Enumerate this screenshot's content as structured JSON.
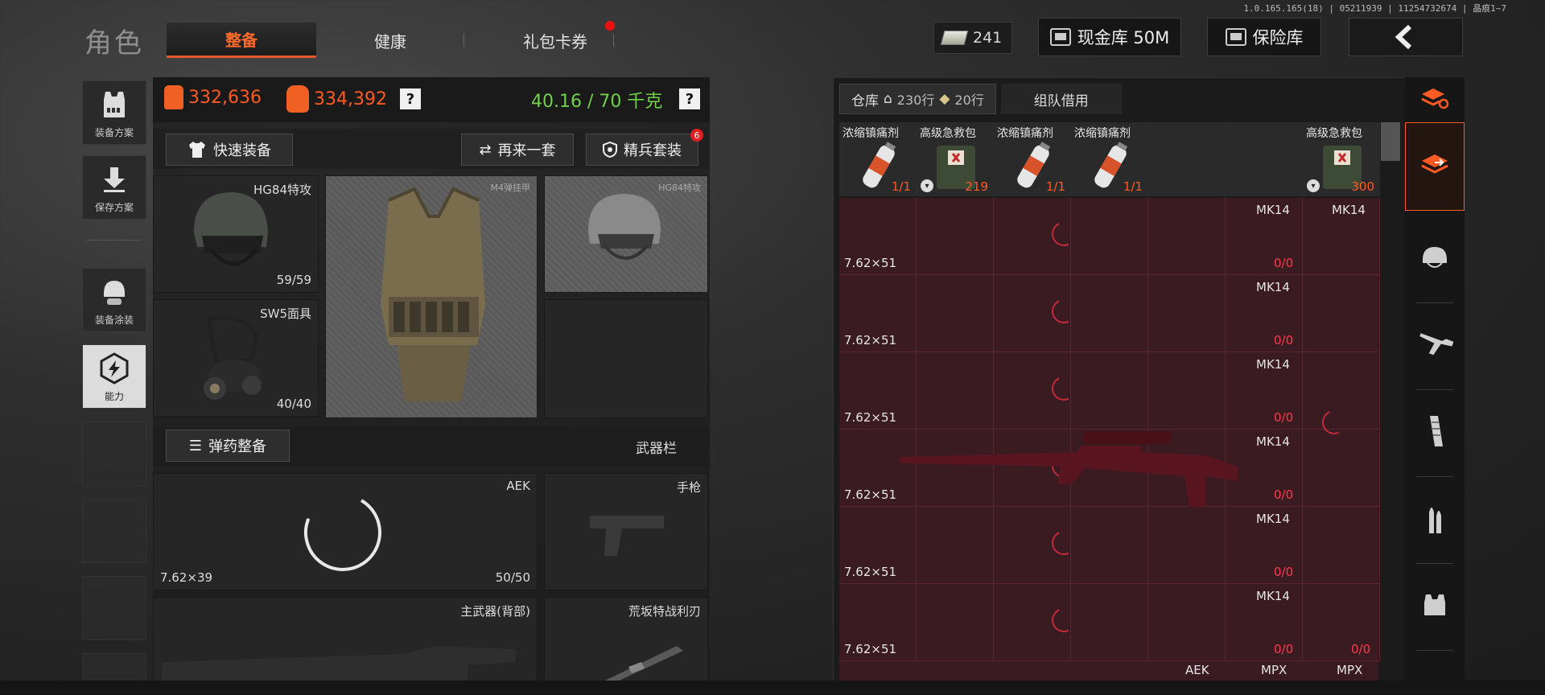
{
  "version": "1.0.165.165(18) | 05211939 | 11254732674 | 晶痕1~7",
  "header": {
    "title": "角色",
    "tabs": [
      {
        "label": "整备",
        "active": true
      },
      {
        "label": "健康",
        "active": false
      },
      {
        "label": "礼包卡券",
        "active": false
      }
    ],
    "money": "241",
    "cash_vault_label": "现金库 50M",
    "safe_label": "保险库",
    "back_icon": "chevron-left-icon",
    "accent_color": "#ff5a24"
  },
  "left_rail": [
    {
      "label": "装备方案",
      "icon": "vest-plan-icon"
    },
    {
      "label": "保存方案",
      "icon": "download-icon"
    },
    {
      "label": "装备涂装",
      "icon": "helmet-paint-icon"
    },
    {
      "label": "能力",
      "icon": "ability-icon"
    }
  ],
  "stats": {
    "value1": "332,636",
    "value2": "334,392",
    "weight": "40.16 / 70 千克",
    "help": "?"
  },
  "actions": {
    "quick_equip": "快速装备",
    "again": "再来一套",
    "elite": "精兵套装",
    "elite_badge": "6"
  },
  "gear": {
    "helmet": {
      "name": "HG84特攻",
      "durability": "59/59"
    },
    "mask": {
      "name": "SW5面具",
      "durability": "40/40"
    },
    "vest": {
      "name": "M4弹挂甲"
    },
    "helmet_ghost": {
      "name": "HG84特攻"
    }
  },
  "ammo_section": {
    "button": "弹药整备",
    "title": "武器栏"
  },
  "weapons": {
    "primary": {
      "name": "AEK",
      "caliber": "7.62×39",
      "ammo": "50/50"
    },
    "pistol": {
      "name": "手枪"
    },
    "back": {
      "name": "主武器(背部)"
    },
    "melee": {
      "name": "荒坂特战利刃"
    }
  },
  "warehouse": {
    "tab_label": "仓库",
    "rows_home": "230行",
    "rows_ticket": "20行",
    "team_tab": "组队借用",
    "top_items": [
      {
        "name": "浓缩镇痛剂",
        "count": "1/1",
        "type": "syringe"
      },
      {
        "name": "高级急救包",
        "count": "219",
        "type": "medkit"
      },
      {
        "name": "浓缩镇痛剂",
        "count": "1/1",
        "type": "syringe"
      },
      {
        "name": "浓缩镇痛剂",
        "count": "1/1",
        "type": "syringe"
      },
      {
        "name": "",
        "count": "",
        "type": "empty"
      },
      {
        "name": "",
        "count": "",
        "type": "empty"
      },
      {
        "name": "高级急救包",
        "count": "300",
        "type": "medkit"
      }
    ],
    "rows": [
      {
        "caliber": "7.62×51",
        "weapon": "MK14",
        "count": "0/0",
        "extra_name": "MK14",
        "extra_count": ""
      },
      {
        "caliber": "7.62×51",
        "weapon": "MK14",
        "count": "0/0",
        "extra_name": "",
        "extra_count": ""
      },
      {
        "caliber": "7.62×51",
        "weapon": "MK14",
        "count": "0/0",
        "extra_name": "",
        "extra_count": ""
      },
      {
        "caliber": "7.62×51",
        "weapon": "MK14",
        "count": "0/0",
        "extra_name": "",
        "extra_count": ""
      },
      {
        "caliber": "7.62×51",
        "weapon": "MK14",
        "count": "0/0",
        "extra_name": "",
        "extra_count": ""
      },
      {
        "caliber": "7.62×51",
        "weapon": "MK14",
        "count": "0/0",
        "extra_name": "",
        "extra_count": "0/0"
      }
    ],
    "last_row": [
      "AEK",
      "MPX",
      "MPX"
    ]
  },
  "right_sidebar": [
    {
      "icon": "stack-refresh-icon"
    },
    {
      "icon": "warehouse-icon",
      "active": true
    },
    {
      "icon": "helmet-icon"
    },
    {
      "icon": "rifle-icon"
    },
    {
      "icon": "magazine-icon"
    },
    {
      "icon": "bullet-icon"
    },
    {
      "icon": "armor-icon"
    }
  ]
}
